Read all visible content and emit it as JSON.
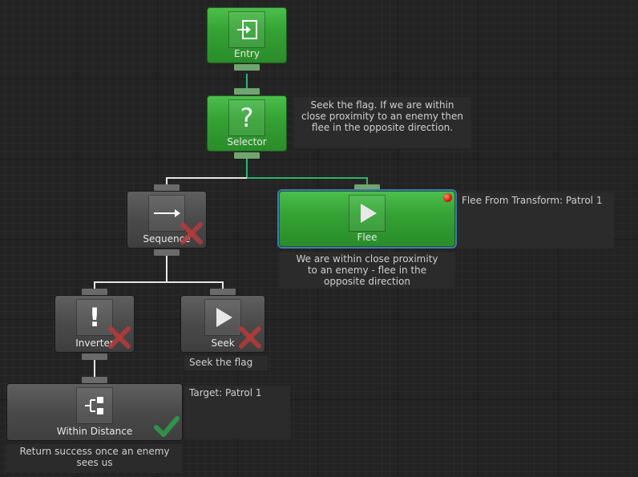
{
  "nodes": {
    "entry": {
      "label": "Entry"
    },
    "selector": {
      "label": "Selector"
    },
    "flee": {
      "label": "Flee"
    },
    "sequence": {
      "label": "Sequence"
    },
    "inverter": {
      "label": "Inverter"
    },
    "seek": {
      "label": "Seek"
    },
    "within_distance": {
      "label": "Within Distance"
    }
  },
  "comments": {
    "selector": "Seek the flag. If we are within close proximity to an enemy then flee in the opposite direction.",
    "flee_details": "Flee From Transform: Patrol 1",
    "flee": "We are within close proximity to an enemy - flee in the opposite direction",
    "seek": "Seek the flag",
    "within_distance_details": "Target: Patrol 1",
    "within_distance": "Return success once an enemy sees us"
  },
  "status": {
    "sequence": "failure",
    "inverter": "failure",
    "seek": "failure",
    "within_distance": "success",
    "flee": "breakpoint"
  },
  "colors": {
    "running_node": "#35a335",
    "idle_node": "#4a4a4a",
    "active_wire": "#2fb36a",
    "inactive_wire": "#e6e6e6",
    "failure_mark": "#b83a3a",
    "success_mark": "#2f9a4a",
    "selection_outline": "#3f79b5"
  }
}
